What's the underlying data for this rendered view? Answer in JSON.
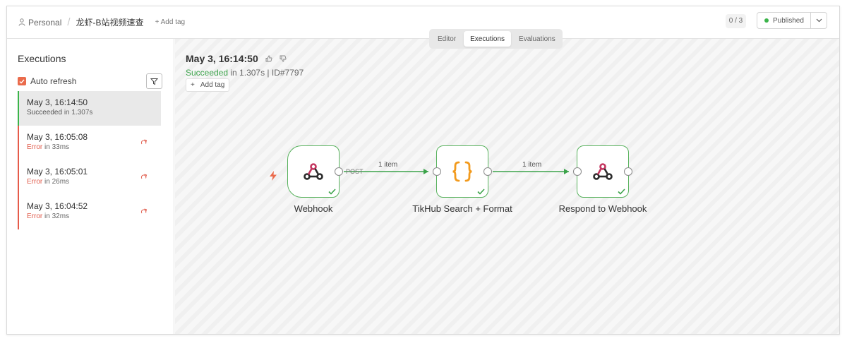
{
  "header": {
    "breadcrumb_personal": "Personal",
    "project_name": "龙虾-B站视频速查",
    "add_tag": "+ Add tag",
    "counter": "0 / 3",
    "publish_label": "Published",
    "status_color": "#3bb44a"
  },
  "tabs": [
    {
      "label": "Editor",
      "active": false
    },
    {
      "label": "Executions",
      "active": true
    },
    {
      "label": "Evaluations",
      "active": false
    }
  ],
  "sidebar": {
    "title": "Executions",
    "auto_refresh_label": "Auto refresh",
    "auto_refresh_checked": true,
    "executions": [
      {
        "date": "May 3, 16:14:50",
        "status": "Succeeded",
        "duration": " in 1.307s",
        "state": "success"
      },
      {
        "date": "May 3, 16:05:08",
        "status": "Error",
        "duration": " in 33ms",
        "state": "error"
      },
      {
        "date": "May 3, 16:05:01",
        "status": "Error",
        "duration": " in 26ms",
        "state": "error"
      },
      {
        "date": "May 3, 16:04:52",
        "status": "Error",
        "duration": " in 32ms",
        "state": "error"
      }
    ]
  },
  "run": {
    "date": "May 3, 16:14:50",
    "status": "Succeeded",
    "duration": " in 1.307s",
    "separator": " | ",
    "id": "ID#7797",
    "add_tag_plus": "+",
    "add_tag": "Add tag"
  },
  "workflow": {
    "nodes": [
      {
        "name": "Webhook",
        "icon": "webhook-icon"
      },
      {
        "name": "TikHub Search + Format",
        "icon": "code-braces-icon"
      },
      {
        "name": "Respond to Webhook",
        "icon": "webhook-icon"
      }
    ],
    "edges": [
      {
        "label": "1 item"
      },
      {
        "label": "1 item"
      }
    ],
    "webhook_method": "POST",
    "success_color": "#3ba34a",
    "accent_color": "#ea6b4c"
  }
}
